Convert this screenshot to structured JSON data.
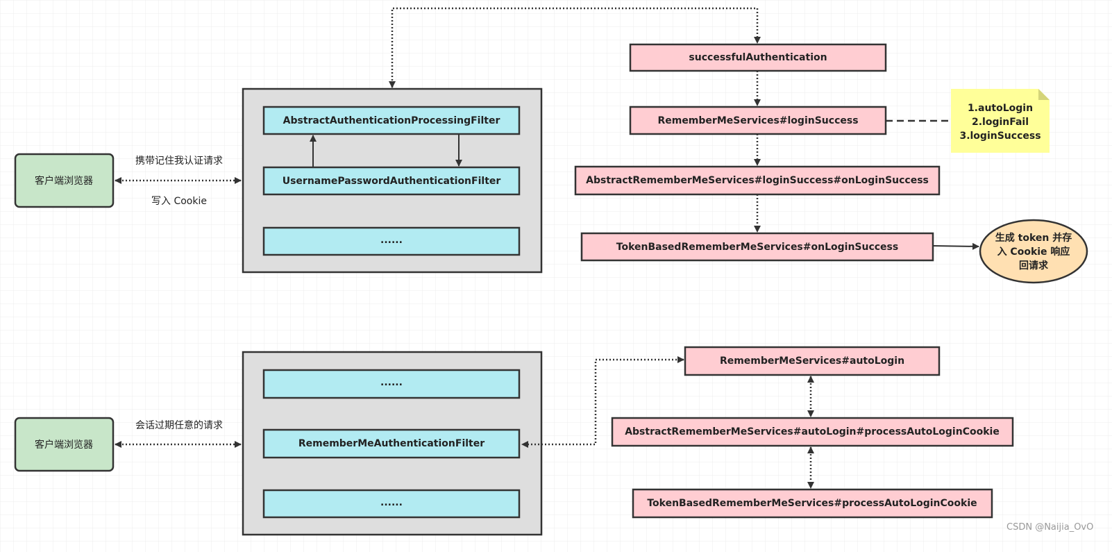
{
  "colors": {
    "filter": "#b2ebf2",
    "service": "#ffcdd2",
    "client": "#c8e6c9",
    "note": "#ffff99",
    "ellipse": "#ffe0b2",
    "container": "#dedede"
  },
  "top": {
    "client": "客户端浏览器",
    "request_label": "携带记住我认证请求",
    "response_label": "写入 Cookie",
    "filters": [
      "AbstractAuthenticationProcessingFilter",
      "UsernamePasswordAuthenticationFilter",
      "......"
    ],
    "services": [
      "successfulAuthentication",
      "RememberMeServices#loginSuccess",
      "AbstractRememberMeServices#loginSuccess#onLoginSuccess",
      "TokenBasedRememberMeServices#onLoginSuccess"
    ],
    "note": [
      "1.autoLogin",
      "2.loginFail",
      "3.loginSuccess"
    ],
    "result": [
      "生成 token 并存",
      "入 Cookie 响应",
      "回请求"
    ]
  },
  "bottom": {
    "client": "客户端浏览器",
    "request_label": "会话过期任意的请求",
    "filters": [
      "......",
      "RememberMeAuthenticationFilter",
      "......"
    ],
    "services": [
      "RememberMeServices#autoLogin",
      "AbstractRememberMeServices#autoLogin#processAutoLoginCookie",
      "TokenBasedRememberMeServices#processAutoLoginCookie"
    ]
  },
  "watermark": "CSDN @Naijia_OvO"
}
